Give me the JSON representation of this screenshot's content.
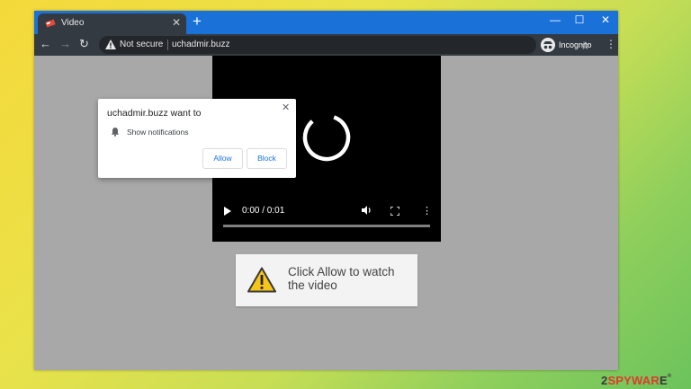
{
  "browser": {
    "tab_title": "Video",
    "tab_close": "✕",
    "new_tab": "+",
    "win_min": "—",
    "win_max": "☐",
    "win_close": "✕",
    "back": "←",
    "forward": "→",
    "reload": "↻",
    "security_label": "Not secure",
    "url": "uchadmir.buzz",
    "star": "☆",
    "incognito_label": "Incognito",
    "menu": "⋮"
  },
  "notification_prompt": {
    "title": "uchadmir.buzz want to",
    "close": "✕",
    "permission": "Show notifications",
    "allow_label": "Allow",
    "block_label": "Block"
  },
  "video": {
    "time": "0:00 / 0:01",
    "more": "⋮"
  },
  "overlay": {
    "message": "Click Allow to watch the video"
  },
  "watermark": {
    "prefix": "2",
    "highlight": "SPYWAR",
    "suffix": "E",
    "mark": "®"
  },
  "colors": {
    "titlebar": "#1a72d9",
    "toolbar": "#343a41",
    "page_bg": "#a8a8a8",
    "link_blue": "#1a73e8",
    "warning_yellow": "#f5c518"
  },
  "icons": [
    "favicon-icon",
    "warning-icon",
    "incognito-icon",
    "bell-icon",
    "spinner-icon",
    "play-icon",
    "volume-icon",
    "fullscreen-icon",
    "alert-triangle-icon"
  ]
}
